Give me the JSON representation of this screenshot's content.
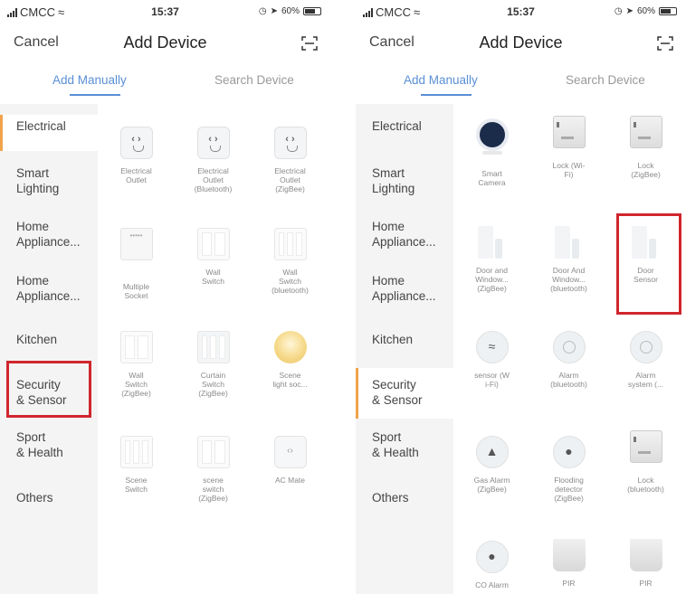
{
  "phone_left": {
    "status": {
      "carrier": "CMCC",
      "time": "15:37",
      "battery": "60%"
    },
    "nav": {
      "cancel": "Cancel",
      "title": "Add Device"
    },
    "tabs": {
      "manual": "Add Manually",
      "search": "Search Device"
    },
    "categories": [
      {
        "l1": "Electrical",
        "l2": "",
        "active": true
      },
      {
        "l1": "Smart",
        "l2": "Lighting"
      },
      {
        "l1": "Home",
        "l2": "Appliance..."
      },
      {
        "l1": "Home",
        "l2": "Appliance..."
      },
      {
        "l1": "Kitchen",
        "l2": ""
      },
      {
        "l1": "Security",
        "l2": "& Sensor"
      },
      {
        "l1": "Sport",
        "l2": "& Health"
      },
      {
        "l1": "Others",
        "l2": ""
      }
    ],
    "devices": [
      {
        "l1": "Electrical",
        "l2": "Outlet",
        "l3": "",
        "icon": "outlet-icon"
      },
      {
        "l1": "Electrical",
        "l2": "Outlet",
        "l3": "(Bluetooth)",
        "icon": "outlet-icon"
      },
      {
        "l1": "Electrical",
        "l2": "Outlet",
        "l3": "(ZigBee)",
        "icon": "outlet-icon"
      },
      {
        "l1": "Multiple",
        "l2": "Socket",
        "l3": "",
        "icon": "power-strip-icon"
      },
      {
        "l1": "Wall",
        "l2": "Switch",
        "l3": "",
        "icon": "wall-switch-icon"
      },
      {
        "l1": "Wall",
        "l2": "Switch",
        "l3": "(bluetooth)",
        "icon": "wall-switch-icon"
      },
      {
        "l1": "Wall",
        "l2": "Switch",
        "l3": "(ZigBee)",
        "icon": "wall-switch-icon"
      },
      {
        "l1": "Curtain",
        "l2": "Switch",
        "l3": "(ZigBee)",
        "icon": "curtain-switch-icon"
      },
      {
        "l1": "Scene",
        "l2": "light soc...",
        "l3": "",
        "icon": "scene-light-icon"
      },
      {
        "l1": "Scene",
        "l2": "Switch",
        "l3": "",
        "icon": "scene-switch-icon"
      },
      {
        "l1": "scene",
        "l2": "switch",
        "l3": "(ZigBee)",
        "icon": "scene-switch-icon"
      },
      {
        "l1": "AC Mate",
        "l2": "",
        "l3": "",
        "icon": "ac-mate-icon"
      }
    ]
  },
  "phone_right": {
    "status": {
      "carrier": "CMCC",
      "time": "15:37",
      "battery": "60%"
    },
    "nav": {
      "cancel": "Cancel",
      "title": "Add Device"
    },
    "tabs": {
      "manual": "Add Manually",
      "search": "Search Device"
    },
    "categories": [
      {
        "l1": "Electrical",
        "l2": ""
      },
      {
        "l1": "Smart",
        "l2": "Lighting"
      },
      {
        "l1": "Home",
        "l2": "Appliance..."
      },
      {
        "l1": "Home",
        "l2": "Appliance..."
      },
      {
        "l1": "Kitchen",
        "l2": ""
      },
      {
        "l1": "Security",
        "l2": "& Sensor",
        "active": true
      },
      {
        "l1": "Sport",
        "l2": "& Health"
      },
      {
        "l1": "Others",
        "l2": ""
      }
    ],
    "devices": [
      {
        "l1": "Smart",
        "l2": "Camera",
        "l3": "",
        "icon": "camera-icon"
      },
      {
        "l1": "Lock (Wi-",
        "l2": "Fi)",
        "l3": "",
        "icon": "door-lock-icon"
      },
      {
        "l1": "Lock",
        "l2": "(ZigBee)",
        "l3": "",
        "icon": "door-lock-icon"
      },
      {
        "l1": "Door and",
        "l2": "Window...",
        "l3": "(ZigBee)",
        "icon": "door-window-sensor-icon"
      },
      {
        "l1": "Door And",
        "l2": "Window...",
        "l3": "(bluetooth)",
        "icon": "door-window-sensor-icon"
      },
      {
        "l1": "Door",
        "l2": "Sensor",
        "l3": "",
        "icon": "door-sensor-icon"
      },
      {
        "l1": "sensor (W",
        "l2": "i-Fi)",
        "l3": "",
        "icon": "sensor-icon"
      },
      {
        "l1": "Alarm",
        "l2": "(bluetooth)",
        "l3": "",
        "icon": "alarm-icon"
      },
      {
        "l1": "Alarm",
        "l2": "system (...",
        "l3": "",
        "icon": "alarm-icon"
      },
      {
        "l1": "Gas Alarm",
        "l2": "(ZigBee)",
        "l3": "",
        "icon": "gas-alarm-icon"
      },
      {
        "l1": "Flooding",
        "l2": "detector",
        "l3": "(ZigBee)",
        "icon": "flood-detector-icon"
      },
      {
        "l1": "Lock",
        "l2": "(bluetooth)",
        "l3": "",
        "icon": "door-lock-icon"
      },
      {
        "l1": "CO Alarm",
        "l2": "",
        "l3": "",
        "icon": "co-alarm-icon"
      },
      {
        "l1": "PIR",
        "l2": "",
        "l3": "",
        "icon": "pir-sensor-icon"
      },
      {
        "l1": "PIR",
        "l2": "",
        "l3": "",
        "icon": "pir-sensor-icon"
      }
    ]
  },
  "colors": {
    "accent": "#5a8fd6",
    "active_bar": "#f1a34c",
    "highlight": "#d0262d"
  }
}
